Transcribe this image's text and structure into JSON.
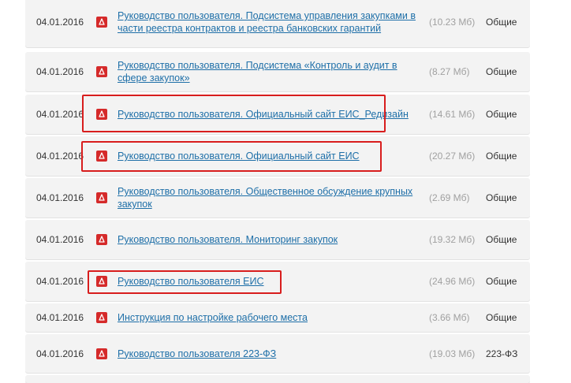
{
  "documents": [
    {
      "date": "04.01.2016",
      "title": "Руководство пользователя. Подсистема управления закупками в части реестра контрактов и реестра банковских гарантий",
      "size": "(10.23 Мб)",
      "category": "Общие",
      "icon": "pdf-icon"
    },
    {
      "date": "04.01.2016",
      "title": "Руководство пользователя. Подсистема «Контроль и аудит в сфере закупок»",
      "size": "(8.27 Мб)",
      "category": "Общие",
      "icon": "pdf-icon"
    },
    {
      "date": "04.01.2016",
      "title": "Руководство пользователя. Официальный сайт ЕИС_Редизайн",
      "size": "(14.61 Мб)",
      "category": "Общие",
      "icon": "pdf-icon",
      "highlighted": true
    },
    {
      "date": "04.01.2016",
      "title": "Руководство пользователя. Официальный сайт ЕИС",
      "size": "(20.27 Мб)",
      "category": "Общие",
      "icon": "pdf-icon",
      "highlighted": true
    },
    {
      "date": "04.01.2016",
      "title": "Руководство пользователя. Общественное обсуждение крупных закупок",
      "size": "(2.69 Мб)",
      "category": "Общие",
      "icon": "pdf-icon"
    },
    {
      "date": "04.01.2016",
      "title": "Руководство пользователя. Мониторинг закупок",
      "size": "(19.32 Мб)",
      "category": "Общие",
      "icon": "pdf-icon"
    },
    {
      "date": "04.01.2016",
      "title": "Руководство пользователя ЕИС",
      "size": "(24.96 Мб)",
      "category": "Общие",
      "icon": "pdf-icon",
      "highlighted": true
    },
    {
      "date": "04.01.2016",
      "title": "Инструкция по настройке рабочего места",
      "size": "(3.66 Мб)",
      "category": "Общие",
      "icon": "pdf-icon"
    },
    {
      "date": "04.01.2016",
      "title": "Руководство пользователя 223-ФЗ",
      "size": "(19.03 Мб)",
      "category": "223-ФЗ",
      "icon": "pdf-icon"
    }
  ],
  "colors": {
    "link": "#1e6fa8",
    "highlight": "#d81d1d",
    "row_bg": "#f3f3f3",
    "pdf_icon": "#d52a2a"
  }
}
